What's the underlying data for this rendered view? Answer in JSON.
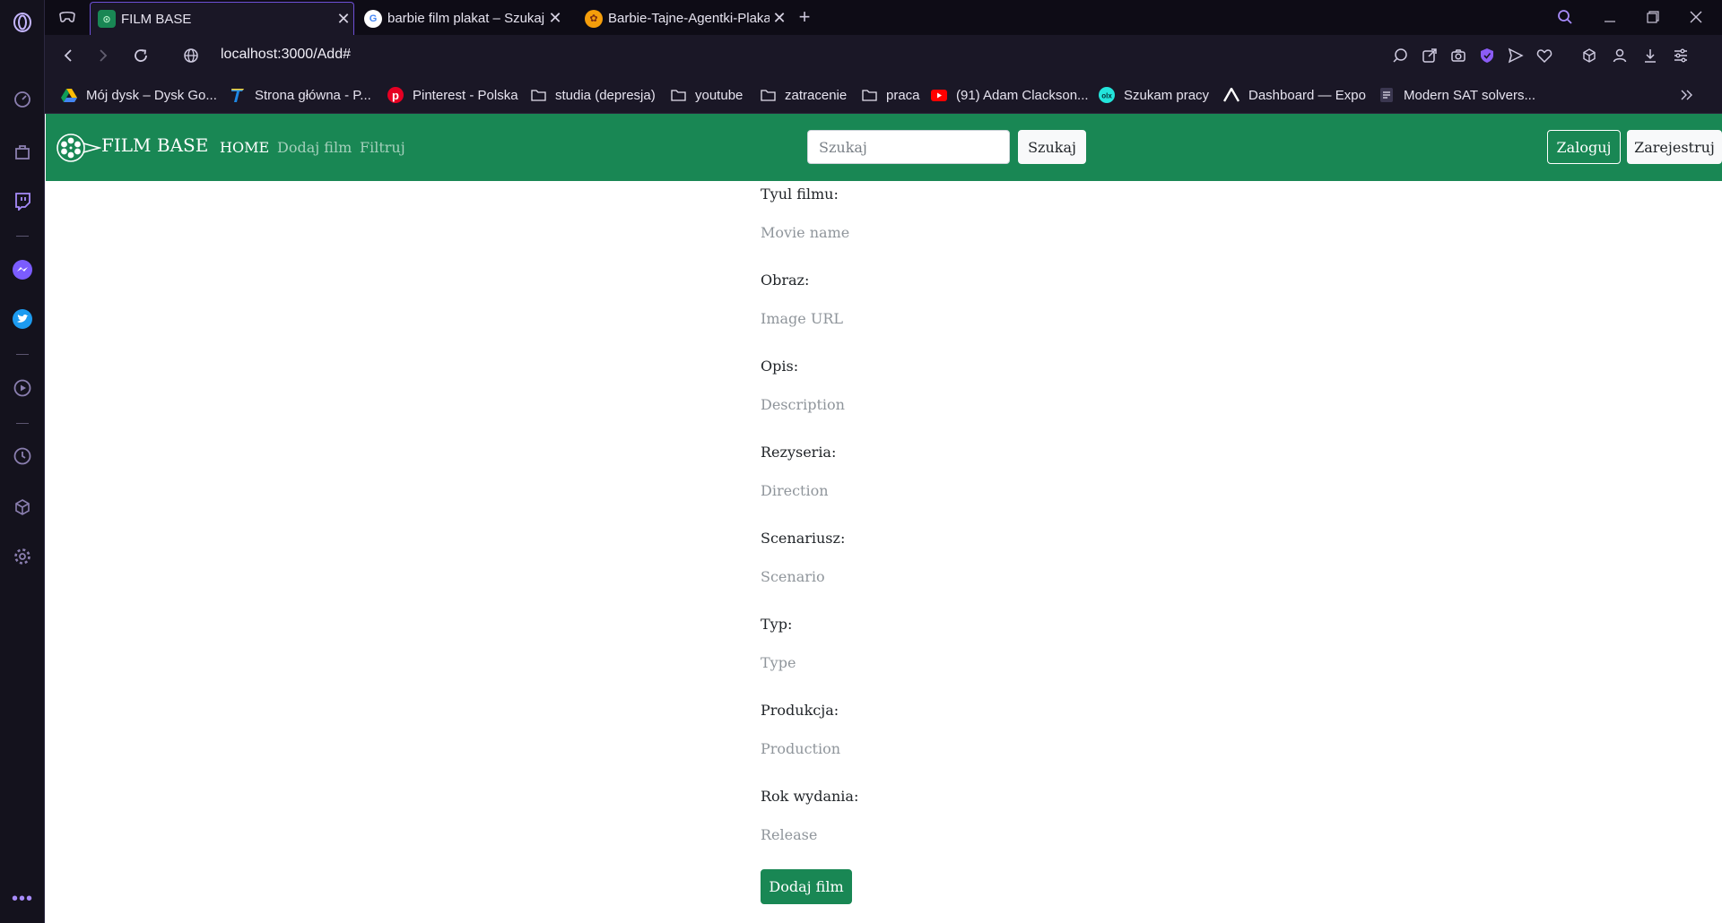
{
  "browser": {
    "tabs": [
      {
        "title": "FILM BASE",
        "favicon": "film-favicon",
        "active": true
      },
      {
        "title": "barbie film plakat – Szukaj w Google",
        "favicon": "google-favicon",
        "active": false
      },
      {
        "title": "Barbie-Tajne-Agentki-Plakat",
        "favicon": "bee-favicon",
        "active": false
      }
    ],
    "new_tab_icon": "plus-icon",
    "url": "localhost:3000/Add#",
    "bookmarks": [
      {
        "label": "Mój dysk – Dysk Go...",
        "icon": "google-drive-icon"
      },
      {
        "label": "Strona główna - P...",
        "icon": "t-logo-icon"
      },
      {
        "label": "Pinterest - Polska",
        "icon": "pinterest-icon"
      },
      {
        "label": "studia (depresja)",
        "icon": "folder-icon"
      },
      {
        "label": "youtube",
        "icon": "folder-icon"
      },
      {
        "label": "zatracenie",
        "icon": "folder-icon"
      },
      {
        "label": "praca",
        "icon": "folder-icon"
      },
      {
        "label": "(91) Adam Clackson...",
        "icon": "youtube-icon"
      },
      {
        "label": "Szukam pracy",
        "icon": "olx-icon"
      },
      {
        "label": "Dashboard — Expo",
        "icon": "expo-icon"
      },
      {
        "label": "Modern SAT solvers...",
        "icon": "doc-icon"
      }
    ]
  },
  "navbar": {
    "brand": "FILM BASE",
    "links": {
      "home": "HOME",
      "add": "Dodaj film",
      "filter": "Filtruj"
    },
    "search_placeholder": "Szukaj",
    "search_button": "Szukaj",
    "login_button": "Zaloguj",
    "register_button": "Zarejestruj"
  },
  "form": {
    "fields": [
      {
        "label": "Tyul filmu:",
        "placeholder": "Movie name"
      },
      {
        "label": "Obraz:",
        "placeholder": "Image URL"
      },
      {
        "label": "Opis:",
        "placeholder": "Description"
      },
      {
        "label": "Rezyseria:",
        "placeholder": "Direction"
      },
      {
        "label": "Scenariusz:",
        "placeholder": "Scenario"
      },
      {
        "label": "Typ:",
        "placeholder": "Type"
      },
      {
        "label": "Produkcja:",
        "placeholder": "Production"
      },
      {
        "label": "Rok wydania:",
        "placeholder": "Release"
      }
    ],
    "submit": "Dodaj film"
  },
  "colors": {
    "navbar_bg": "#198754",
    "browser_bg": "#1a1726",
    "accent": "#a78bfa"
  }
}
